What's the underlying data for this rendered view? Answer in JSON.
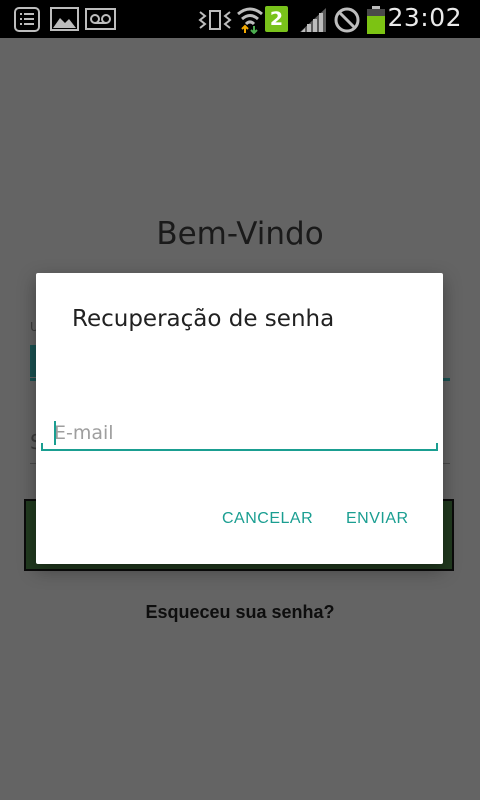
{
  "status_bar": {
    "time": "23:02",
    "sim_badge": "2",
    "icons": [
      "notes-icon",
      "image-icon",
      "voicemail-icon",
      "vibrate-icon",
      "wifi-icon",
      "sim-2-icon",
      "signal-icon",
      "no-sync-icon",
      "battery-icon"
    ],
    "battery_color": "#7cc313"
  },
  "login": {
    "title": "Bem-Vindo",
    "user_hint_fragment": "U",
    "password_hint_fragment": "S",
    "forgot_password": "Esqueceu sua senha?"
  },
  "dialog": {
    "title": "Recuperação de senha",
    "email": {
      "value": "",
      "placeholder": "E-mail"
    },
    "cancel_label": "CANCELAR",
    "send_label": "ENVIAR",
    "accent_color": "#1a9e91"
  }
}
